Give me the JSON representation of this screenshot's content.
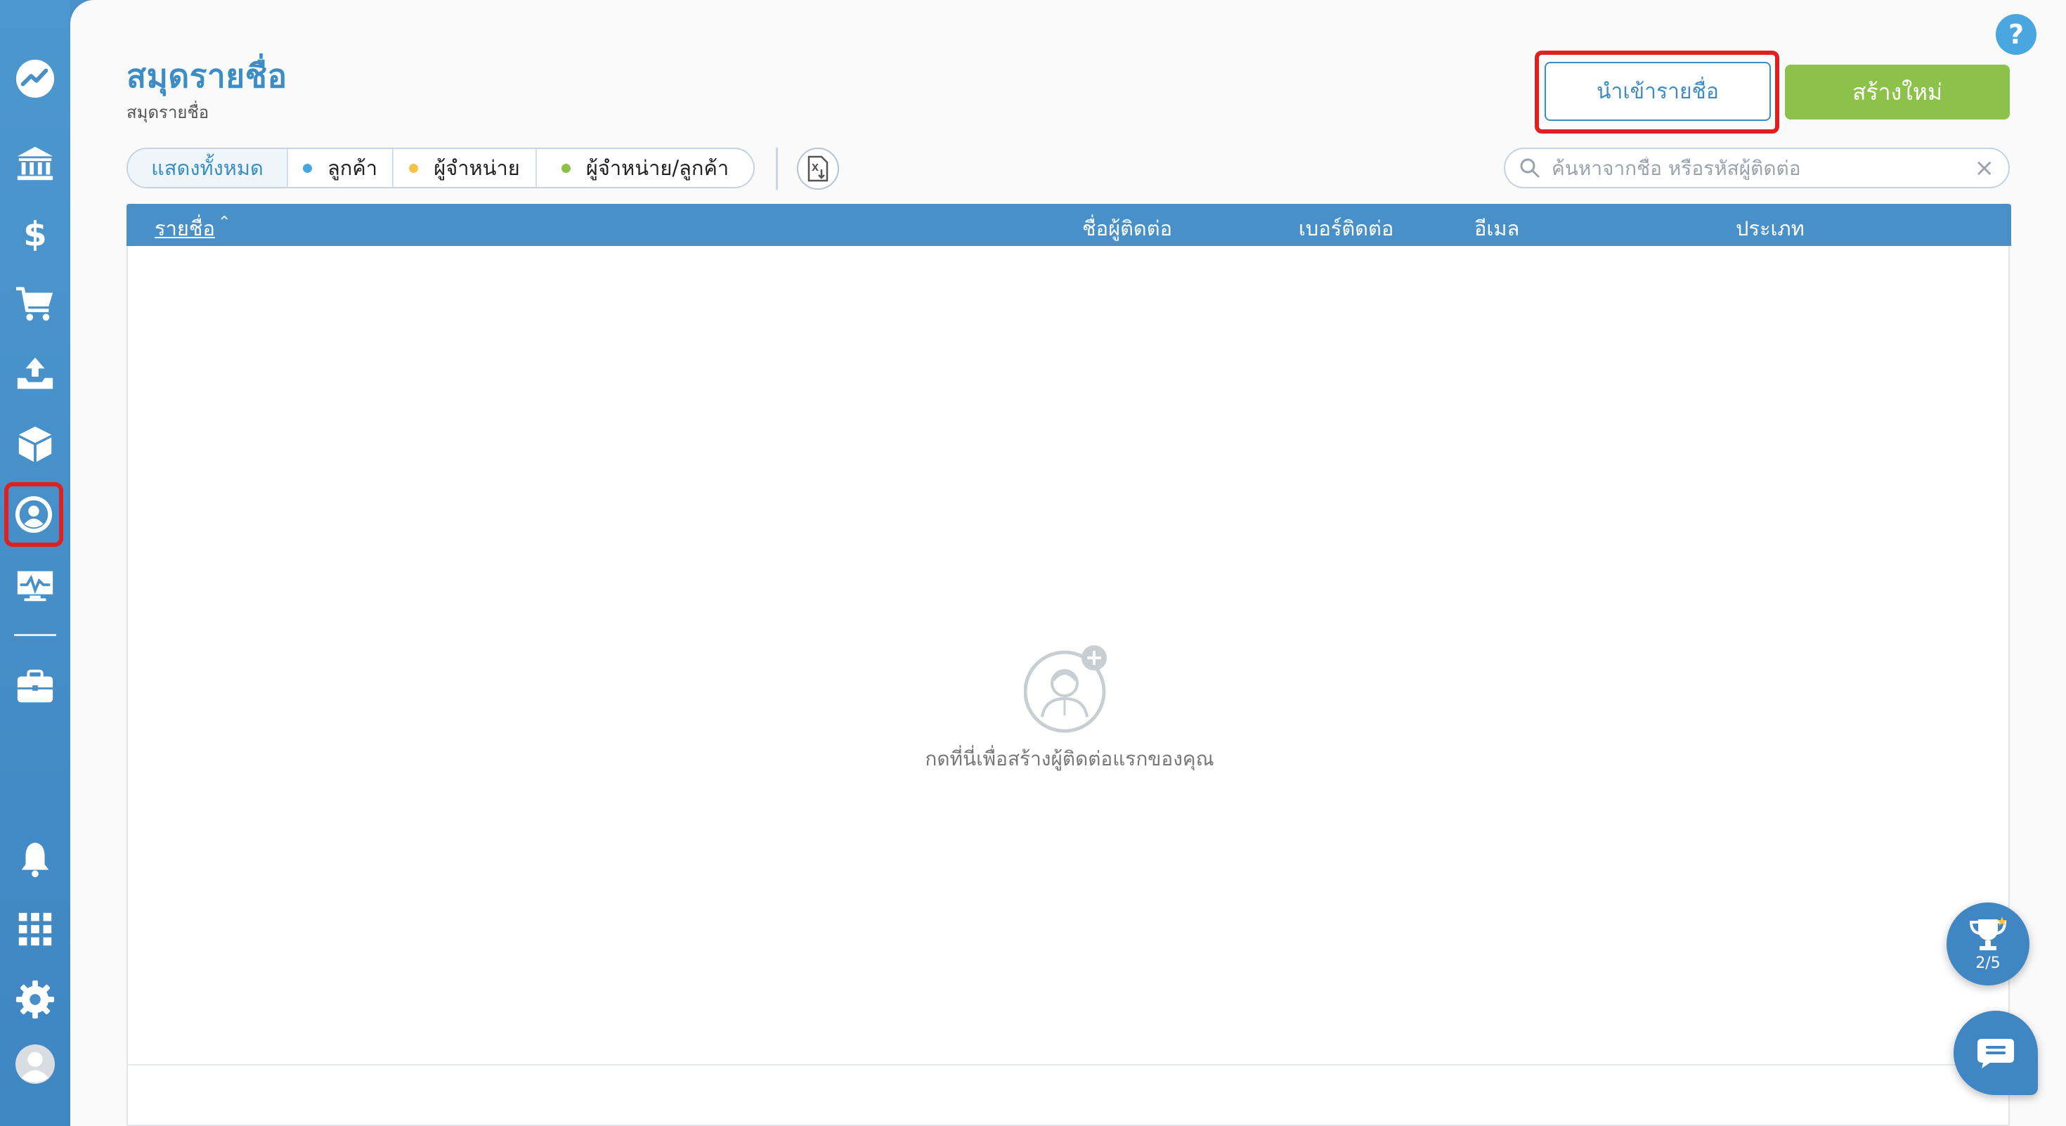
{
  "page": {
    "title": "สมุดรายชื่อ",
    "breadcrumb": "สมุดรายชื่อ"
  },
  "sidebar": {
    "items": [
      {
        "name": "dashboard",
        "icon": "chart-line-icon"
      },
      {
        "name": "bank",
        "icon": "bank-icon"
      },
      {
        "name": "income",
        "icon": "dollar-icon"
      },
      {
        "name": "expenses",
        "icon": "cart-icon"
      },
      {
        "name": "upload",
        "icon": "upload-tray-icon"
      },
      {
        "name": "products",
        "icon": "box-icon"
      },
      {
        "name": "contacts",
        "icon": "user-circle-icon",
        "active": true
      },
      {
        "name": "reports",
        "icon": "monitor-pulse-icon"
      },
      {
        "name": "business",
        "icon": "briefcase-icon"
      },
      {
        "name": "notifications",
        "icon": "bell-icon"
      },
      {
        "name": "apps",
        "icon": "grid-icon"
      },
      {
        "name": "settings",
        "icon": "gear-icon"
      },
      {
        "name": "profile",
        "icon": "avatar-icon"
      }
    ]
  },
  "toolbar": {
    "import_label": "นำเข้ารายชื่อ",
    "create_label": "สร้างใหม่",
    "help_label": "?"
  },
  "filters": [
    {
      "label": "แสดงทั้งหมด",
      "active": true,
      "dot_color": null
    },
    {
      "label": "ลูกค้า",
      "active": false,
      "dot_color": "#4aa6df"
    },
    {
      "label": "ผู้จำหน่าย",
      "active": false,
      "dot_color": "#f5c34a"
    },
    {
      "label": "ผู้จำหน่าย/ลูกค้า",
      "active": false,
      "dot_color": "#8cc14a"
    }
  ],
  "search": {
    "placeholder": "ค้นหาจากชื่อ หรือรหัสผู้ติดต่อ",
    "value": ""
  },
  "table": {
    "columns": {
      "name": "รายชื่อ",
      "sort_indicator": "^",
      "contact_person": "ชื่อผู้ติดต่อ",
      "phone": "เบอร์ติดต่อ",
      "email": "อีเมล",
      "type": "ประเภท"
    },
    "rows": []
  },
  "empty_state": {
    "text": "กดที่นี่เพื่อสร้างผู้ติดต่อแรกของคุณ"
  },
  "achievements": {
    "progress": "2/5"
  },
  "colors": {
    "primary": "#3c8dc4",
    "header": "#4a90c8",
    "success": "#8cc14a",
    "highlight": "#e02020"
  }
}
